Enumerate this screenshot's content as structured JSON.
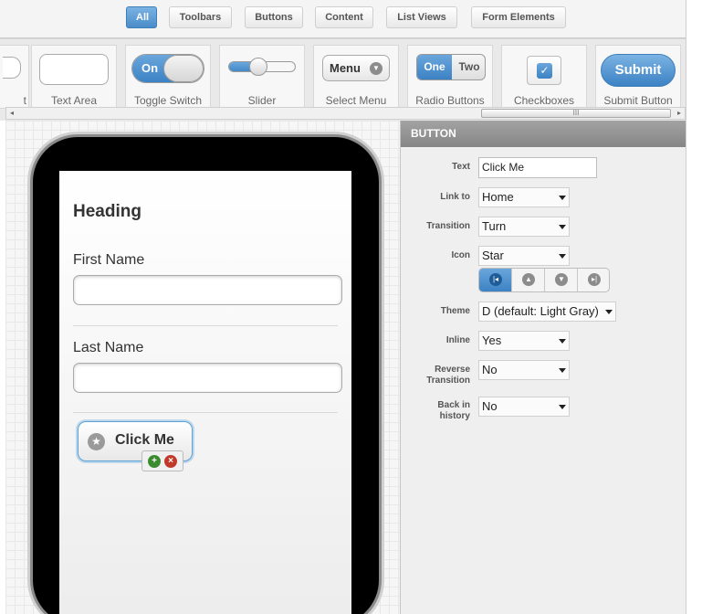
{
  "filters": [
    {
      "label": "All",
      "active": true
    },
    {
      "label": "Toolbars",
      "active": false
    },
    {
      "label": "Buttons",
      "active": false
    },
    {
      "label": "Content",
      "active": false
    },
    {
      "label": "List Views",
      "active": false
    },
    {
      "label": "Form Elements",
      "active": false
    }
  ],
  "palette": {
    "items": [
      {
        "label": "t"
      },
      {
        "label": "Text Area"
      },
      {
        "label": "Toggle Switch",
        "on_text": "On"
      },
      {
        "label": "Slider",
        "value_fraction": 0.45
      },
      {
        "label": "Select Menu",
        "menu_text": "Menu"
      },
      {
        "label": "Radio Buttons",
        "options": [
          "One",
          "Two"
        ]
      },
      {
        "label": "Checkboxes"
      },
      {
        "label": "Submit Button",
        "button_text": "Submit"
      }
    ],
    "scroll_grip": "III",
    "scroll_left": "◂",
    "scroll_right": "▸"
  },
  "preview": {
    "heading": "Heading",
    "first_name_label": "First Name",
    "last_name_label": "Last Name",
    "button_text": "Click Me",
    "button_icon": "star-icon",
    "add_icon": "plus-icon",
    "remove_icon": "close-icon"
  },
  "panel": {
    "title": "BUTTON",
    "text_label": "Text",
    "text_value": "Click Me",
    "link_label": "Link to",
    "link_value": "Home",
    "transition_label": "Transition",
    "transition_value": "Turn",
    "icon_label": "Icon",
    "icon_value": "Star",
    "icon_positions": [
      "left",
      "top",
      "bottom",
      "right"
    ],
    "icon_position_selected": "left",
    "theme_label": "Theme",
    "theme_value": "D (default: Light Gray)",
    "inline_label": "Inline",
    "inline_value": "Yes",
    "reverse_label_1": "Reverse",
    "reverse_label_2": "Transition",
    "reverse_value": "No",
    "history_label_1": "Back in",
    "history_label_2": "history",
    "history_value": "No"
  },
  "colors": {
    "accent": "#4a8cc9",
    "panel_header": "#8f8f8f",
    "add_green": "#3a8a2e",
    "remove_red": "#c0392b"
  }
}
